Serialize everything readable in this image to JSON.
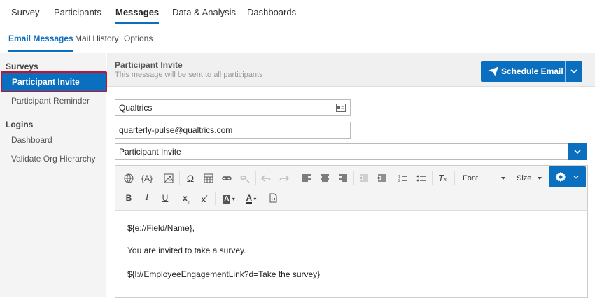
{
  "topnav": {
    "tabs": [
      {
        "label": "Survey"
      },
      {
        "label": "Participants"
      },
      {
        "label": "Messages"
      },
      {
        "label": "Data & Analysis"
      },
      {
        "label": "Dashboards"
      }
    ],
    "active": "Messages"
  },
  "subnav": {
    "tabs": [
      {
        "label": "Email Messages"
      },
      {
        "label": "Mail History"
      },
      {
        "label": "Options"
      }
    ],
    "active": "Email Messages"
  },
  "sidebar": {
    "sections": [
      {
        "title": "Surveys",
        "items": [
          "Participant Invite",
          "Participant Reminder"
        ]
      },
      {
        "title": "Logins",
        "items": [
          "Dashboard",
          "Validate Org Hierarchy"
        ]
      }
    ],
    "selected": "Participant Invite"
  },
  "header": {
    "title": "Participant Invite",
    "subtitle": "This message will be sent to all participants",
    "schedule_label": "Schedule Email"
  },
  "form": {
    "from_name": "Qualtrics",
    "from_email": "quarterly-pulse@qualtrics.com",
    "message_select": "Participant Invite"
  },
  "toolbar": {
    "font_label": "Font",
    "size_label": "Size"
  },
  "body": {
    "lines": [
      "${e://Field/Name},",
      "You are invited to take a survey.",
      "${l://EmployeeEngagementLink?d=Take the survey}"
    ]
  },
  "colors": {
    "accent": "#0b6fbf",
    "highlight_border": "#c8102e"
  }
}
